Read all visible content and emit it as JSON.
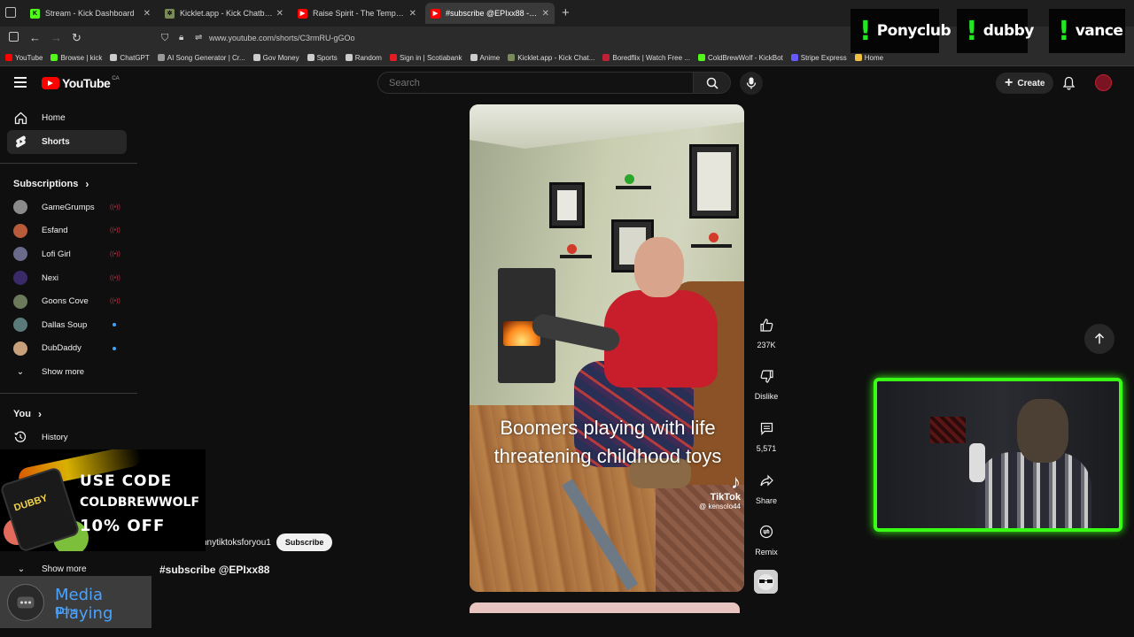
{
  "browser": {
    "tabs": [
      {
        "title": "Stream - Kick Dashboard",
        "fav_color": "#53fc18",
        "fav_text": "K"
      },
      {
        "title": "Kicklet.app - Kick Chatbot and C",
        "fav_color": "#7a8b5a",
        "fav_text": "✲"
      },
      {
        "title": "Raise Spirit - The Temple - YouTube",
        "fav_color": "#ff0000",
        "fav_text": "▶"
      },
      {
        "title": "#subscribe @EPIxx88 - YouTube",
        "fav_color": "#ff0000",
        "fav_text": "▶"
      }
    ],
    "url": "www.youtube.com/shorts/C3rmRU-gGOo",
    "bookmarks": [
      {
        "label": "YouTube",
        "color": "#ff0000"
      },
      {
        "label": "Browse | kick",
        "color": "#53fc18"
      },
      {
        "label": "ChatGPT",
        "color": "#cccccc"
      },
      {
        "label": "AI Song Generator | Cr...",
        "color": "#999999"
      },
      {
        "label": "Gov Money",
        "color": "#cccccc"
      },
      {
        "label": "Sports",
        "color": "#cccccc"
      },
      {
        "label": "Random",
        "color": "#cccccc"
      },
      {
        "label": "Sign in | Scotiabank",
        "color": "#e31b23"
      },
      {
        "label": "Anime",
        "color": "#cccccc"
      },
      {
        "label": "Kicklet.app - Kick Chat...",
        "color": "#7a8b5a"
      },
      {
        "label": "Boredflix | Watch Free ...",
        "color": "#c02035"
      },
      {
        "label": "ColdBrewWolf - KickBot",
        "color": "#53fc18"
      },
      {
        "label": "Stripe Express",
        "color": "#635bff"
      },
      {
        "label": "Home",
        "color": "#f0c040"
      }
    ]
  },
  "header": {
    "logo_text": "YouTube",
    "country": "CA",
    "search_placeholder": "Search",
    "create_label": "Create"
  },
  "sidebar": {
    "home": "Home",
    "shorts": "Shorts",
    "subscriptions_heading": "Subscriptions",
    "subscriptions": [
      {
        "name": "GameGrumps",
        "color": "#8a8a8a",
        "status": "live"
      },
      {
        "name": "Esfand",
        "color": "#b85b3b",
        "status": "live"
      },
      {
        "name": "Lofi Girl",
        "color": "#6a6a8a",
        "status": "live"
      },
      {
        "name": "Nexi",
        "color": "#3a2a6a",
        "status": "live"
      },
      {
        "name": "Goons Cove",
        "color": "#6a7a5a",
        "status": "live"
      },
      {
        "name": "Dallas Soup",
        "color": "#5a7a7a",
        "status": "new"
      },
      {
        "name": "DubDaddy",
        "color": "#c8a07a",
        "status": "new"
      }
    ],
    "show_more": "Show more",
    "you_heading": "You",
    "history": "History",
    "show_more_bottom": "Show more"
  },
  "promo": {
    "line1": "USE CODE",
    "line2": "COLDBREWWOLF",
    "line3": "10% OFF",
    "brand": "DUBBY"
  },
  "short": {
    "caption": "Boomers playing with life threatening childhood toys",
    "watermark_brand": "TikTok",
    "watermark_user": "@ kensolo44",
    "channel_name": "nnytiktoksforyou1",
    "subscribe_label": "Subscribe",
    "title": "#subscribe @EPIxx88"
  },
  "actions": {
    "likes": "237K",
    "dislike": "Dislike",
    "comments": "5,571",
    "share": "Share",
    "remix": "Remix"
  },
  "overlays": {
    "alerts": [
      "Ponyclub",
      "dubby",
      "vance"
    ],
    "media_title": "Media Playing",
    "media_sub": "None"
  }
}
